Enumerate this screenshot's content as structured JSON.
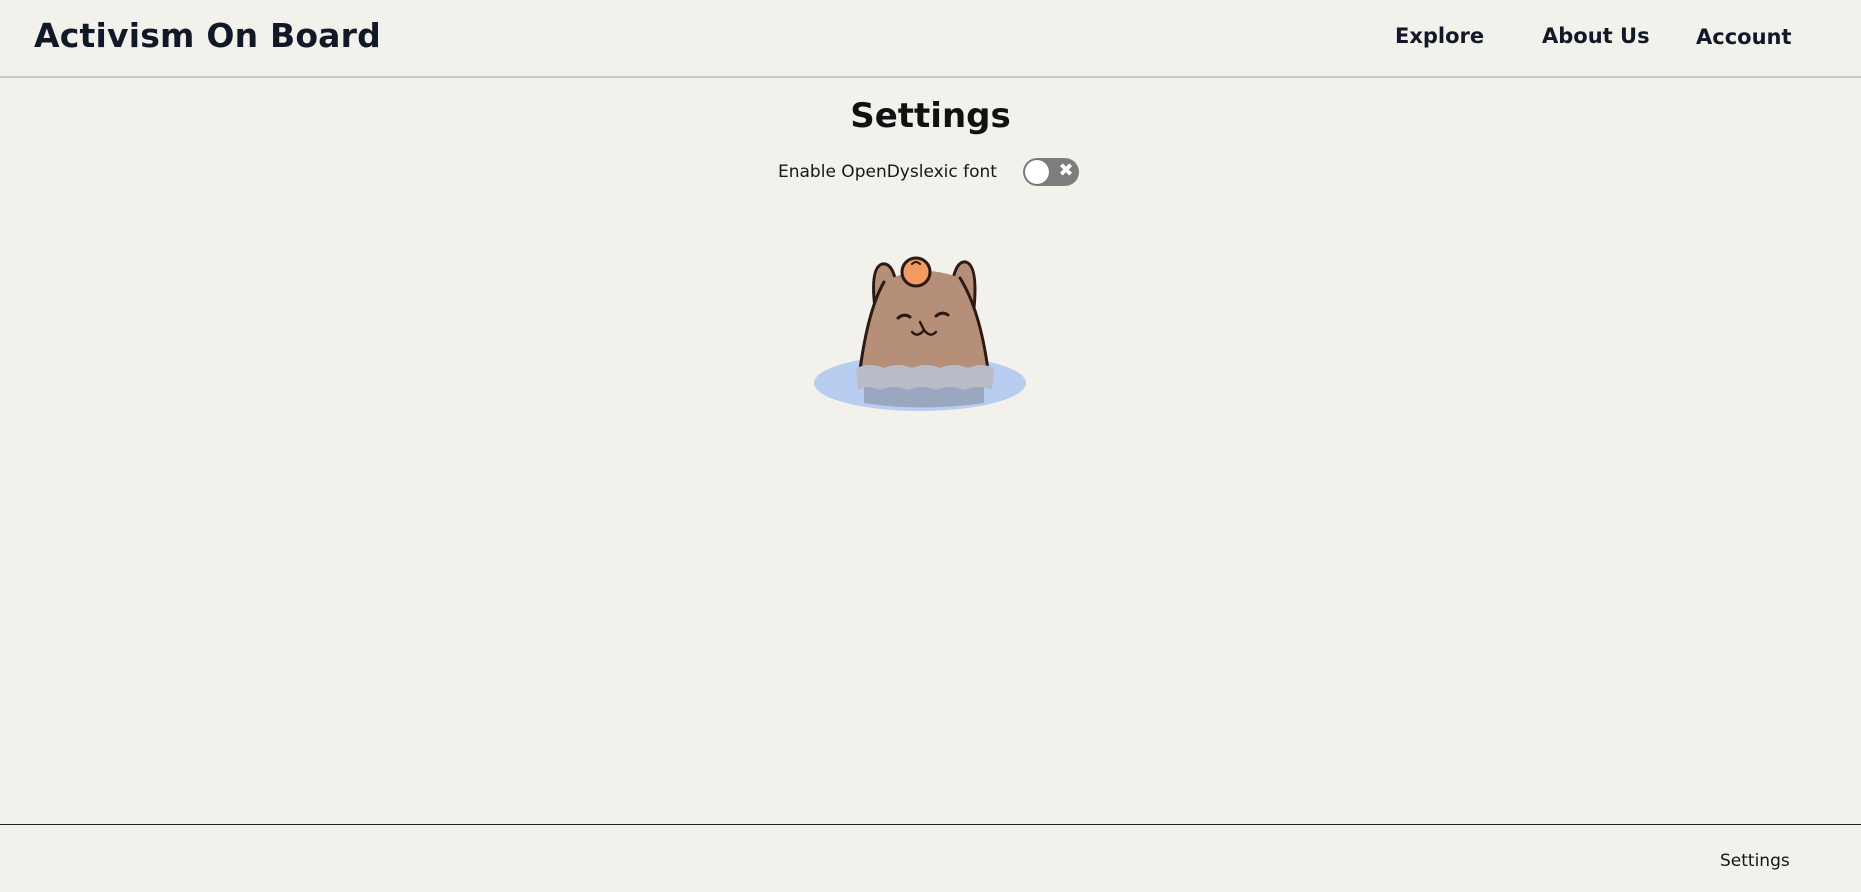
{
  "header": {
    "brand": "Activism On Board",
    "nav": [
      {
        "label": "Explore"
      },
      {
        "label": "About Us"
      },
      {
        "label": "Account"
      }
    ]
  },
  "main": {
    "title": "Settings",
    "settings": [
      {
        "label": "Enable OpenDyslexic font",
        "enabled": false,
        "off_glyph": "✖"
      }
    ],
    "mascot_icon": "capybara-in-water-with-orange-icon"
  },
  "footer": {
    "link": "Settings"
  },
  "colors": {
    "background": "#f2f1ec",
    "toggle_off": "#7d7d7d",
    "text": "#111827"
  }
}
